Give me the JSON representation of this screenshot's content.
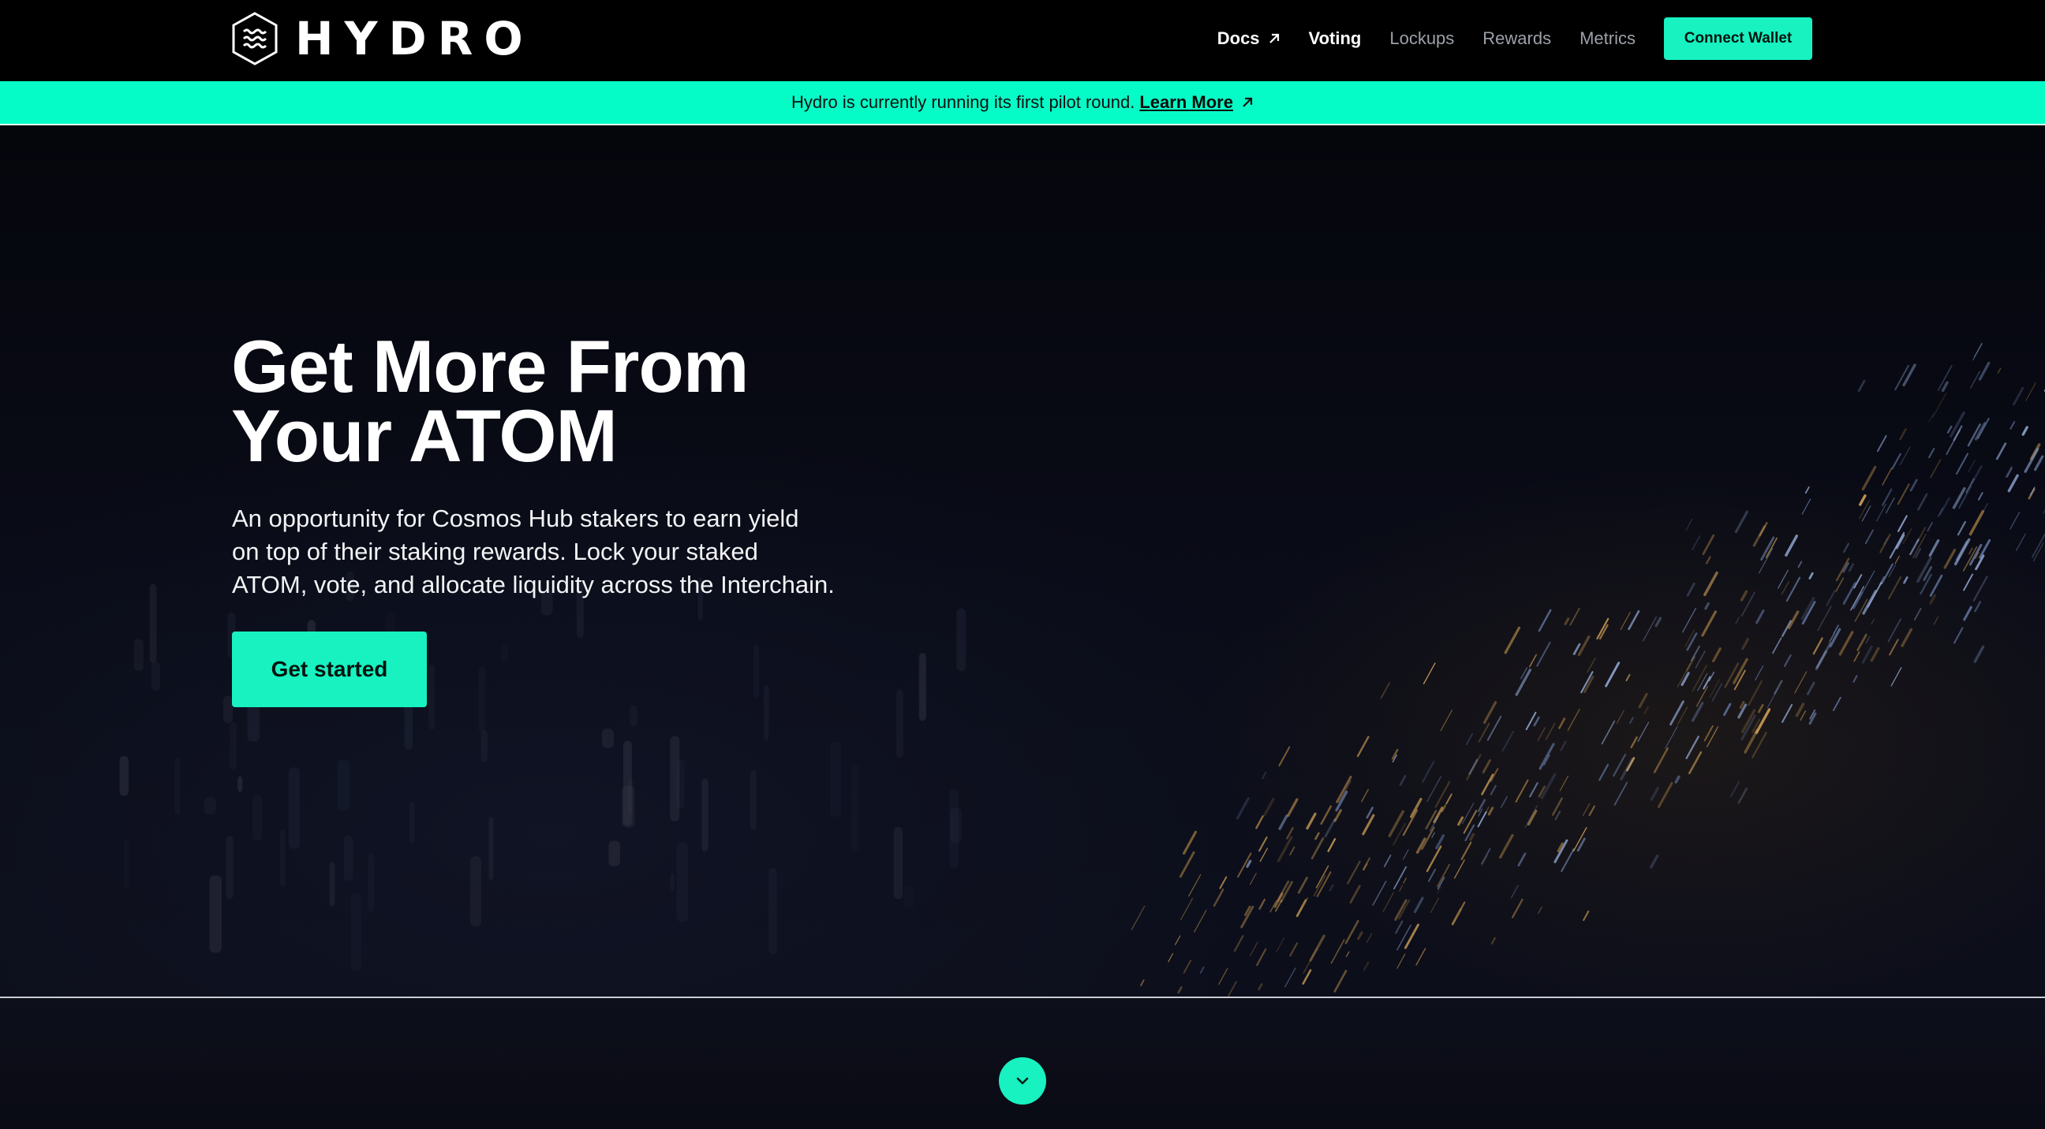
{
  "brand": {
    "name": "HYDRO",
    "logo_icon": "hexagon-waves-icon"
  },
  "nav": {
    "items": [
      {
        "label": "Docs",
        "icon": "external-arrow-icon",
        "active": true
      },
      {
        "label": "Voting",
        "active": true
      },
      {
        "label": "Lockups",
        "active": false
      },
      {
        "label": "Rewards",
        "active": false
      },
      {
        "label": "Metrics",
        "active": false
      }
    ],
    "connect_label": "Connect Wallet"
  },
  "banner": {
    "text": "Hydro is currently running its first pilot round.",
    "link_label": "Learn More",
    "link_icon": "external-arrow-icon"
  },
  "hero": {
    "title_line1": "Get More From",
    "title_line2": "Your ATOM",
    "subtitle_line1": "An opportunity for Cosmos Hub stakers to earn yield",
    "subtitle_line2": "on top of their staking rewards. Lock your staked",
    "subtitle_line3": "ATOM, vote, and allocate liquidity across the Interchain.",
    "cta_label": "Get started"
  },
  "scroll": {
    "icon": "chevron-down-icon"
  },
  "colors": {
    "accent": "#17f2c0",
    "banner_bg": "#06fcc6",
    "header_bg": "#000000",
    "hero_bg": "#0a0c18"
  }
}
